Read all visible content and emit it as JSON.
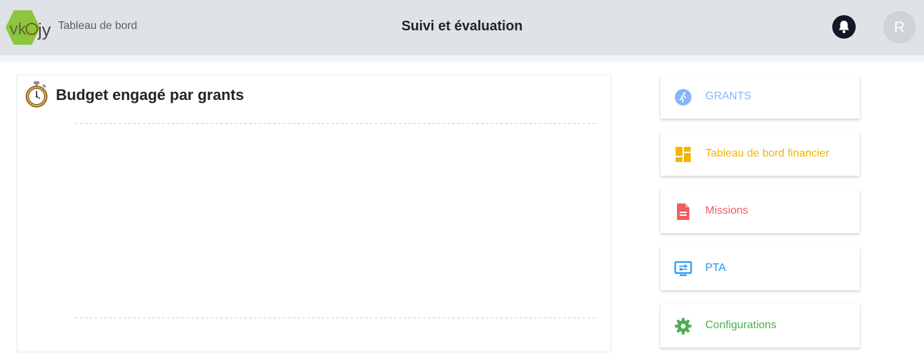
{
  "header": {
    "logo_text": "vkojy",
    "brand_subtitle": "Tableau de bord",
    "page_title": "Suivi et évaluation",
    "avatar_initial": "R"
  },
  "panel": {
    "title": "Budget engagé par grants"
  },
  "chart_data": {
    "type": "bar",
    "title": "Budget engagé par grants",
    "categories": [],
    "series": [],
    "grid": true
  },
  "menu": {
    "items": [
      {
        "label": "GRANTS",
        "icon": "running-person-icon",
        "color": "#8ab4f8"
      },
      {
        "label": "Tableau de bord financier",
        "icon": "dashboard-grid-icon",
        "color": "#f4b400"
      },
      {
        "label": "Missions",
        "icon": "document-icon",
        "color": "#f25c5c"
      },
      {
        "label": "PTA",
        "icon": "monitor-transfer-icon",
        "color": "#2196f3"
      },
      {
        "label": "Configurations",
        "icon": "gear-icon",
        "color": "#4caf50"
      }
    ]
  }
}
